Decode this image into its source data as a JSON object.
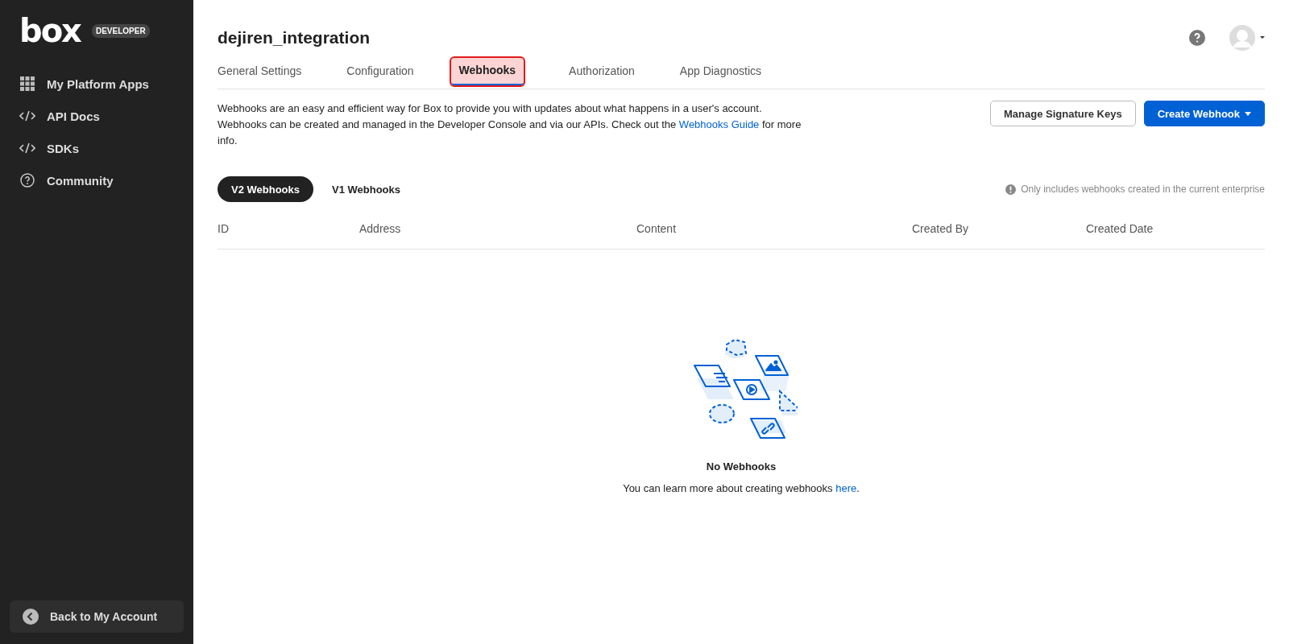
{
  "sidebar": {
    "logo": "box",
    "badge": "DEVELOPER",
    "items": [
      {
        "kind": "grid",
        "label": "My Platform Apps"
      },
      {
        "kind": "code",
        "label": "API Docs"
      },
      {
        "kind": "code",
        "label": "SDKs"
      },
      {
        "kind": "help",
        "label": "Community"
      }
    ],
    "back_button": "Back to My Account"
  },
  "header": {
    "title": "dejiren_integration"
  },
  "tabs": [
    {
      "label": "General Settings",
      "selected": false,
      "highlighted": false
    },
    {
      "label": "Configuration",
      "selected": false,
      "highlighted": false
    },
    {
      "label": "Webhooks",
      "selected": true,
      "highlighted": true
    },
    {
      "label": "Authorization",
      "selected": false,
      "highlighted": false
    },
    {
      "label": "App Diagnostics",
      "selected": false,
      "highlighted": false
    }
  ],
  "description": {
    "before": "Webhooks are an easy and efficient way for Box to provide you with updates about what happens in a user's account. Webhooks can be created and managed in the Developer Console and via our APIs. Check out the",
    "link": "Webhooks Guide",
    "after": "for more info."
  },
  "buttons": {
    "secondary": "Manage Signature Keys",
    "primary": "Create Webhook"
  },
  "subtabs": [
    {
      "label": "V2 Webhooks",
      "selected": true
    },
    {
      "label": "V1 Webhooks",
      "selected": false
    }
  ],
  "notice": "Only includes webhooks created in the current enterprise",
  "table": {
    "columns": [
      "ID",
      "Address",
      "Content",
      "Created By",
      "Created Date"
    ]
  },
  "empty_state": {
    "title": "No Webhooks",
    "before": "You can learn more about creating webhooks",
    "link": "here",
    "after": "."
  }
}
